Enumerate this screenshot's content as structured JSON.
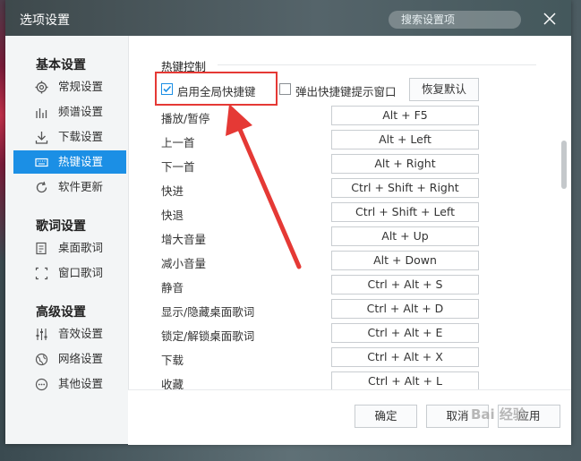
{
  "window": {
    "title": "选项设置",
    "search_placeholder": "搜索设置项"
  },
  "sidebar": {
    "groups": [
      {
        "label": "基本设置",
        "items": [
          {
            "label": "常规设置",
            "icon": "gear-icon"
          },
          {
            "label": "频谱设置",
            "icon": "spectrum-bars-icon"
          },
          {
            "label": "下载设置",
            "icon": "download-icon"
          },
          {
            "label": "热键设置",
            "icon": "keyboard-icon",
            "active": true
          },
          {
            "label": "软件更新",
            "icon": "refresh-icon"
          }
        ]
      },
      {
        "label": "歌词设置",
        "items": [
          {
            "label": "桌面歌词",
            "icon": "desktop-lyrics-icon"
          },
          {
            "label": "窗口歌词",
            "icon": "window-lyrics-icon"
          }
        ]
      },
      {
        "label": "高级设置",
        "items": [
          {
            "label": "音效设置",
            "icon": "equalizer-icon"
          },
          {
            "label": "网络设置",
            "icon": "globe-icon"
          },
          {
            "label": "其他设置",
            "icon": "more-icon"
          }
        ]
      }
    ]
  },
  "content": {
    "section_title": "热键控制",
    "enable_global_label": "启用全局快捷键",
    "enable_global_checked": true,
    "popup_hint_label": "弹出快捷键提示窗口",
    "popup_hint_checked": false,
    "restore_default_label": "恢复默认",
    "hotkeys": [
      {
        "label": "播放/暂停",
        "keys": "Alt + F5"
      },
      {
        "label": "上一首",
        "keys": "Alt + Left"
      },
      {
        "label": "下一首",
        "keys": "Alt + Right"
      },
      {
        "label": "快进",
        "keys": "Ctrl + Shift + Right"
      },
      {
        "label": "快退",
        "keys": "Ctrl + Shift + Left"
      },
      {
        "label": "增大音量",
        "keys": "Alt + Up"
      },
      {
        "label": "减小音量",
        "keys": "Alt + Down"
      },
      {
        "label": "静音",
        "keys": "Ctrl + Alt + S"
      },
      {
        "label": "显示/隐藏桌面歌词",
        "keys": "Ctrl + Alt + D"
      },
      {
        "label": "锁定/解锁桌面歌词",
        "keys": "Ctrl + Alt + E"
      },
      {
        "label": "下载",
        "keys": "Ctrl + Alt + X"
      },
      {
        "label": "收藏",
        "keys": "Ctrl + Alt + L"
      }
    ]
  },
  "footer": {
    "ok_label": "确定",
    "cancel_label": "取消",
    "apply_label": "应用"
  },
  "colors": {
    "accent": "#1b8fe5",
    "annotation_red": "#e53935"
  }
}
